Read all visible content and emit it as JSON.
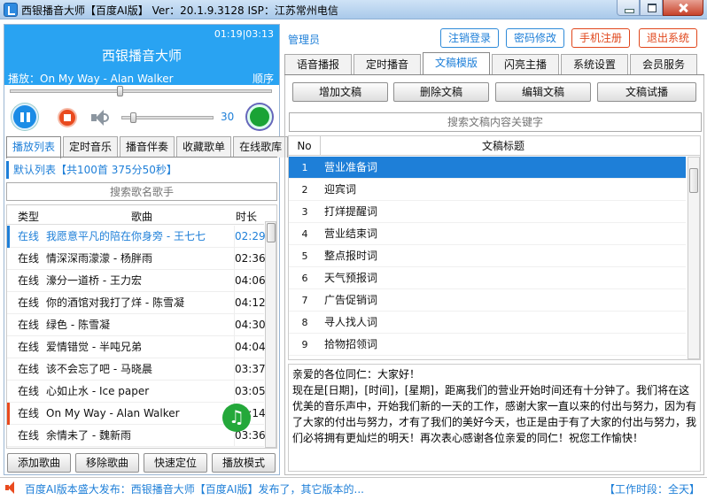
{
  "window": {
    "title": "西银播音大师【百度AI版】 Ver：20.1.9.3128  ISP：江苏常州电信"
  },
  "player": {
    "time": "01:19|03:13",
    "title": "西银播音大师",
    "playing": "播放：On My Way - Alan Walker",
    "mode": "顺序",
    "progress_fraction": 0.41,
    "volume": "30",
    "volume_fraction": 0.1
  },
  "left_tabs": [
    "播放列表",
    "定时音乐",
    "播音伴奏",
    "收藏歌单",
    "在线歌库"
  ],
  "playlist": {
    "info": "默认列表【共100首 375分50秒】",
    "search_placeholder": "搜索歌名歌手",
    "headers": {
      "type": "类型",
      "song": "歌曲",
      "duration": "时长"
    },
    "rows": [
      {
        "type": "在线",
        "song": "我愿意平凡的陪在你身旁 - 王七七",
        "duration": "02:29"
      },
      {
        "type": "在线",
        "song": "情深深雨濛濛 - 杨胖雨",
        "duration": "02:36"
      },
      {
        "type": "在线",
        "song": "�april一道桥 - 王力宏",
        "duration": "04:06"
      },
      {
        "type": "在线",
        "song": "你的酒馆对我打了烊 - 陈雪凝",
        "duration": "04:12"
      },
      {
        "type": "在线",
        "song": "绿色 - 陈雪凝",
        "duration": "04:30"
      },
      {
        "type": "在线",
        "song": "爱情错觉 - 半吨兄弟",
        "duration": "04:04"
      },
      {
        "type": "在线",
        "song": "该不会忘了吧 - 马晓晨",
        "duration": "03:37"
      },
      {
        "type": "在线",
        "song": "心如止水 - Ice paper",
        "duration": "03:05"
      },
      {
        "type": "在线",
        "song": "On My Way - Alan Walker",
        "duration": "03:14"
      },
      {
        "type": "在线",
        "song": "余情未了 - 魏新雨",
        "duration": "03:36"
      }
    ]
  },
  "left_buttons": [
    "添加歌曲",
    "移除歌曲",
    "快速定位",
    "播放模式"
  ],
  "header": {
    "admin": "管理员",
    "buttons": [
      "注销登录",
      "密码修改",
      "手机注册",
      "退出系统"
    ]
  },
  "right_tabs": [
    "语音播报",
    "定时播音",
    "文稿模版",
    "闪亮主播",
    "系统设置",
    "会员服务"
  ],
  "doc_buttons": [
    "增加文稿",
    "删除文稿",
    "编辑文稿",
    "文稿试播"
  ],
  "doc_search_placeholder": "搜索文稿内容关键字",
  "doc_grid": {
    "headers": {
      "no": "No",
      "title": "文稿标题"
    },
    "rows": [
      {
        "no": "1",
        "title": "营业准备词"
      },
      {
        "no": "2",
        "title": "迎宾词"
      },
      {
        "no": "3",
        "title": "打烊提醒词"
      },
      {
        "no": "4",
        "title": "营业结束词"
      },
      {
        "no": "5",
        "title": "整点报时词"
      },
      {
        "no": "6",
        "title": "天气预报词"
      },
      {
        "no": "7",
        "title": "广告促销词"
      },
      {
        "no": "8",
        "title": "寻人找人词"
      },
      {
        "no": "9",
        "title": "拾物招领词"
      }
    ]
  },
  "doc_text": {
    "line1": "亲爱的各位同仁：大家好！",
    "body": "现在是[日期]，[时间]，[星期]，距离我们的营业开始时间还有十分钟了。我们将在这优美的音乐声中，开始我们新的一天的工作，感谢大家一直以来的付出与努力，因为有了大家的付出与努力，才有了我们的美好今天，也正是由于有了大家的付出与努力，我们必将拥有更灿烂的明天！再次表心感谢各位亲爱的同仁！祝您工作愉快！"
  },
  "status": {
    "message": "百度AI版本盛大发布：西银播音大师【百度AI版】发布了，其它版本的...",
    "hours": "【工作时段：全天】"
  },
  "colors": {
    "accent": "#1e7fd8",
    "player_bg": "#29a3f2",
    "danger": "#e0461b",
    "playing_marker": "#e94a1e"
  }
}
